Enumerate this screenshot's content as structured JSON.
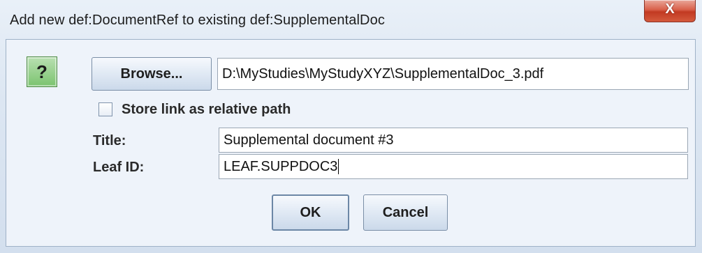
{
  "window": {
    "title": "Add new def:DocumentRef to existing def:SupplementalDoc",
    "close_glyph": "X"
  },
  "icon": {
    "name": "help-question-icon",
    "glyph": "?",
    "color": "#7bc36f"
  },
  "browse": {
    "label": "Browse...",
    "path_value": "D:\\MyStudies\\MyStudyXYZ\\SupplementalDoc_3.pdf"
  },
  "relative_path": {
    "label": "Store link as relative path",
    "checked": false
  },
  "form": {
    "title_label": "Title:",
    "title_value": "Supplemental document #3",
    "leaf_label": "Leaf ID:",
    "leaf_value": "LEAF.SUPPDOC3"
  },
  "buttons": {
    "ok_label": "OK",
    "cancel_label": "Cancel"
  }
}
